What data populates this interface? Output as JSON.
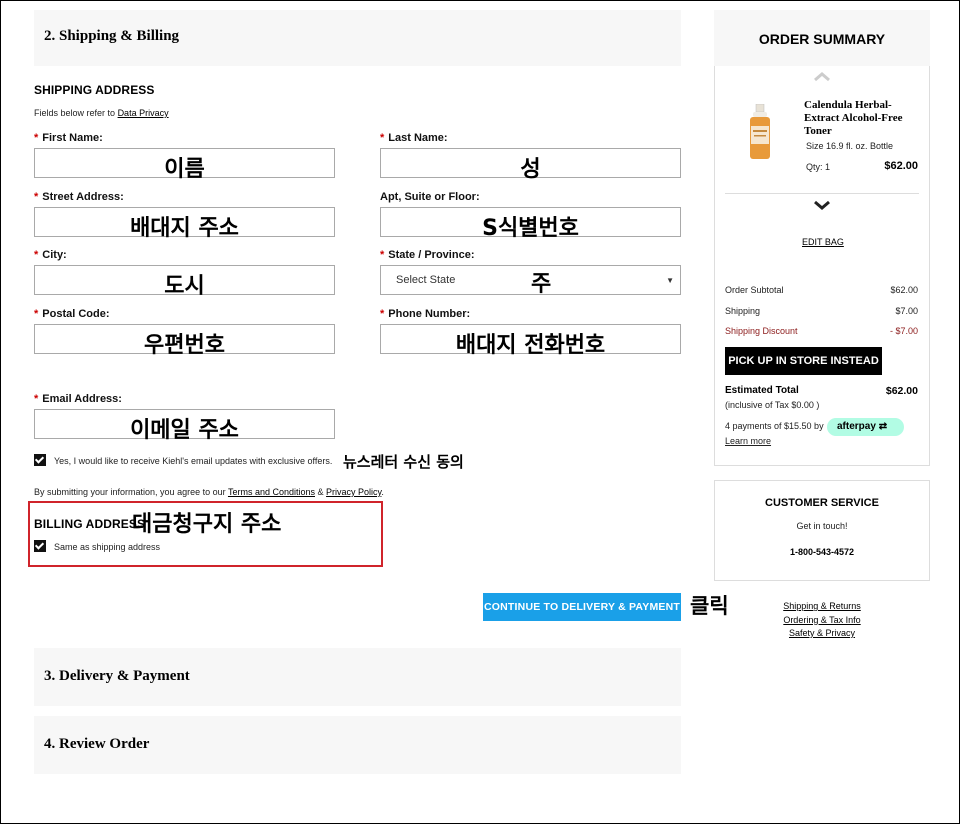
{
  "sections": {
    "shipping_billing": "2. Shipping & Billing",
    "delivery_payment": "3. Delivery & Payment",
    "review_order": "4. Review Order"
  },
  "shipping": {
    "heading": "SHIPPING ADDRESS",
    "privacy_prefix": "Fields below refer to",
    "privacy_link": "Data Privacy",
    "fields": {
      "first_name": {
        "label": "First Name:",
        "required": true,
        "annotation": "이름"
      },
      "last_name": {
        "label": "Last Name:",
        "required": true,
        "annotation": "성"
      },
      "street": {
        "label": "Street Address:",
        "required": true,
        "annotation": "배대지 주소"
      },
      "apt": {
        "label": "Apt, Suite or Floor:",
        "required": false,
        "annotation": "S식별번호"
      },
      "city": {
        "label": "City:",
        "required": true,
        "annotation": "도시"
      },
      "state": {
        "label": "State / Province:",
        "required": true,
        "placeholder": "Select State",
        "annotation": "주"
      },
      "postal": {
        "label": "Postal Code:",
        "required": true,
        "annotation": "우편번호"
      },
      "phone": {
        "label": "Phone Number:",
        "required": true,
        "annotation": "배대지 전화번호"
      },
      "email": {
        "label": "Email Address:",
        "required": true,
        "annotation": "이메일 주소"
      }
    },
    "required_mark": "*",
    "newsletter": {
      "text": "Yes, I would like to receive Kiehl's email updates with exclusive offers.",
      "checked": true,
      "annotation": "뉴스레터 수신 동의"
    },
    "terms": {
      "prefix": "By submitting your information, you agree to our",
      "terms_link": "Terms and Conditions",
      "amp": "&",
      "privacy_link": "Privacy Policy",
      "suffix": "."
    }
  },
  "billing": {
    "heading": "BILLING ADDRESS",
    "annotation": "대금청구지 주소",
    "same_as_shipping": "Same as shipping address",
    "checked": true
  },
  "cta": {
    "label": "CONTINUE TO DELIVERY & PAYMENT",
    "annotation": "클릭"
  },
  "order_summary": {
    "title": "ORDER SUMMARY",
    "product": {
      "name": "Calendula Herbal-Extract Alcohol-Free Toner",
      "size": "Size 16.9 fl. oz. Bottle",
      "qty": "Qty: 1",
      "price": "$62.00"
    },
    "edit_bag": "EDIT BAG",
    "lines": [
      {
        "label": "Order Subtotal",
        "value": "$62.00",
        "color": "#222222"
      },
      {
        "label": "Shipping",
        "value": "$7.00",
        "color": "#222222"
      },
      {
        "label": "Shipping Discount",
        "value": "- $7.00",
        "color": "#8b1a1a"
      }
    ],
    "pickup_button": "PICK UP IN STORE INSTEAD",
    "estimated_total_label": "Estimated Total",
    "estimated_total_value": "$62.00",
    "tax_note": "(inclusive of Tax $0.00 )",
    "afterpay_text": "4 payments of $15.50 by",
    "afterpay_badge": "afterpay",
    "learn_more": "Learn more"
  },
  "customer_service": {
    "title": "CUSTOMER SERVICE",
    "subtitle": "Get in touch!",
    "phone": "1-800-543-4572"
  },
  "footer_links": [
    "Shipping & Returns",
    "Ordering & Tax Info",
    "Safety & Privacy"
  ],
  "colors": {
    "cta_blue": "#1aa0e8",
    "required_red": "#cc0000",
    "highlight_red": "#d0242b",
    "afterpay_green": "#b2fce4"
  }
}
